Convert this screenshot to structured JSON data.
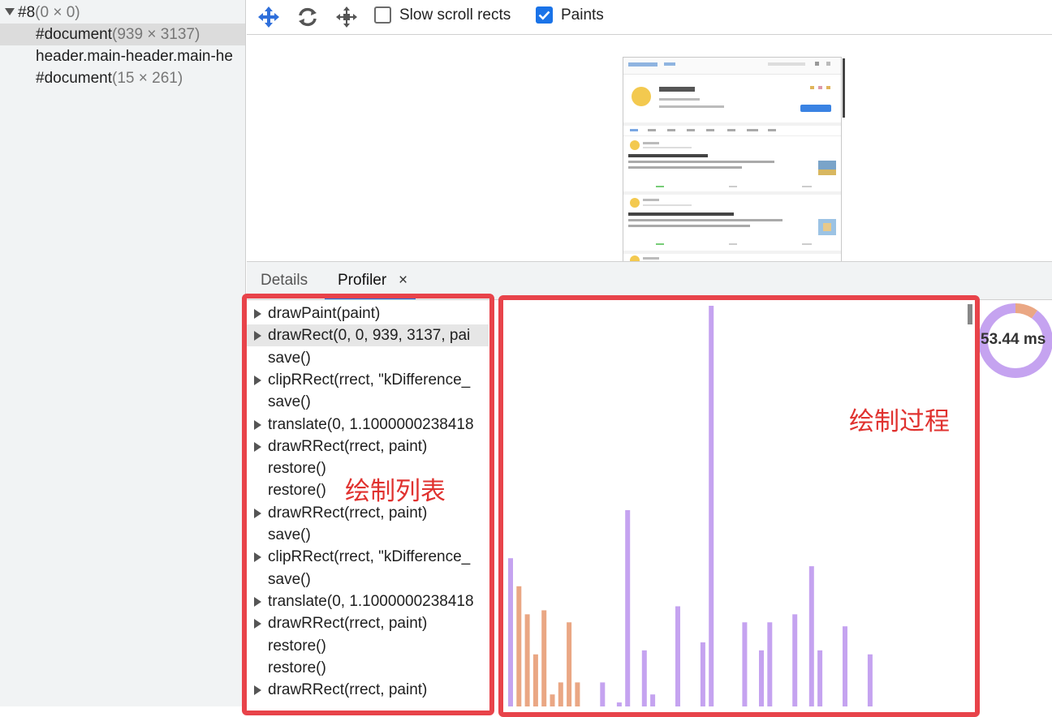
{
  "layer_tree": {
    "rows": [
      {
        "name": "#8",
        "dims": "(0 × 0)",
        "expanded": true,
        "selected": false
      },
      {
        "name": "#document",
        "dims": "(939 × 3137)",
        "selected": true
      },
      {
        "name": "header.main-header.main-he",
        "dims": "",
        "selected": false
      },
      {
        "name": "#document",
        "dims": "(15 × 261)",
        "selected": false
      }
    ]
  },
  "toolbar": {
    "pan_icon": "move-arrows-icon",
    "rotate_icon": "rotate-icon",
    "reset_icon": "reset-transform-icon",
    "slow_scroll_label": "Slow scroll rects",
    "slow_scroll_checked": false,
    "paints_label": "Paints",
    "paints_checked": true
  },
  "tabs": {
    "details": "Details",
    "profiler": "Profiler",
    "close": "×"
  },
  "commands": [
    {
      "text": "drawPaint(paint)",
      "expandable": true
    },
    {
      "text": "drawRect(0, 0, 939, 3137, pai",
      "expandable": true,
      "selected": true
    },
    {
      "text": "save()",
      "expandable": false
    },
    {
      "text": "clipRRect(rrect, \"kDifference_",
      "expandable": true
    },
    {
      "text": "save()",
      "expandable": false
    },
    {
      "text": "translate(0, 1.1000000238418",
      "expandable": true
    },
    {
      "text": "drawRRect(rrect, paint)",
      "expandable": true
    },
    {
      "text": "restore()",
      "expandable": false
    },
    {
      "text": "restore()",
      "expandable": false
    },
    {
      "text": "drawRRect(rrect, paint)",
      "expandable": true
    },
    {
      "text": "save()",
      "expandable": false
    },
    {
      "text": "clipRRect(rrect, \"kDifference_",
      "expandable": true
    },
    {
      "text": "save()",
      "expandable": false
    },
    {
      "text": "translate(0, 1.1000000238418",
      "expandable": true
    },
    {
      "text": "drawRRect(rrect, paint)",
      "expandable": true
    },
    {
      "text": "restore()",
      "expandable": false
    },
    {
      "text": "restore()",
      "expandable": false
    },
    {
      "text": "drawRRect(rrect, paint)",
      "expandable": true
    }
  ],
  "profiler": {
    "total_time": "53.44 ms",
    "donut": {
      "purple_fraction": 0.9,
      "orange_fraction": 0.1
    },
    "colors": {
      "purple": "#c5a3f0",
      "orange": "#eaa784",
      "highlight": "#e8434a"
    },
    "bars": [
      {
        "v": 0.37,
        "c": "purple"
      },
      {
        "v": 0.3,
        "c": "orange"
      },
      {
        "v": 0.23,
        "c": "orange"
      },
      {
        "v": 0.13,
        "c": "orange"
      },
      {
        "v": 0.24,
        "c": "orange"
      },
      {
        "v": 0.03,
        "c": "orange"
      },
      {
        "v": 0.06,
        "c": "orange"
      },
      {
        "v": 0.21,
        "c": "orange"
      },
      {
        "v": 0.06,
        "c": "orange"
      },
      {
        "v": 0.0,
        "c": "purple"
      },
      {
        "v": 0.0,
        "c": "purple"
      },
      {
        "v": 0.06,
        "c": "purple"
      },
      {
        "v": 0.0,
        "c": "purple"
      },
      {
        "v": 0.01,
        "c": "purple"
      },
      {
        "v": 0.49,
        "c": "purple"
      },
      {
        "v": 0.0,
        "c": "purple"
      },
      {
        "v": 0.14,
        "c": "purple"
      },
      {
        "v": 0.03,
        "c": "purple"
      },
      {
        "v": 0.0,
        "c": "purple"
      },
      {
        "v": 0.0,
        "c": "purple"
      },
      {
        "v": 0.25,
        "c": "purple"
      },
      {
        "v": 0.0,
        "c": "purple"
      },
      {
        "v": 0.0,
        "c": "purple"
      },
      {
        "v": 0.16,
        "c": "purple"
      },
      {
        "v": 1.0,
        "c": "purple"
      },
      {
        "v": 0.0,
        "c": "purple"
      },
      {
        "v": 0.0,
        "c": "purple"
      },
      {
        "v": 0.0,
        "c": "purple"
      },
      {
        "v": 0.21,
        "c": "purple"
      },
      {
        "v": 0.0,
        "c": "purple"
      },
      {
        "v": 0.14,
        "c": "purple"
      },
      {
        "v": 0.21,
        "c": "purple"
      },
      {
        "v": 0.0,
        "c": "purple"
      },
      {
        "v": 0.0,
        "c": "purple"
      },
      {
        "v": 0.23,
        "c": "purple"
      },
      {
        "v": 0.0,
        "c": "purple"
      },
      {
        "v": 0.35,
        "c": "purple"
      },
      {
        "v": 0.14,
        "c": "purple"
      },
      {
        "v": 0.0,
        "c": "purple"
      },
      {
        "v": 0.0,
        "c": "purple"
      },
      {
        "v": 0.2,
        "c": "purple"
      },
      {
        "v": 0.0,
        "c": "purple"
      },
      {
        "v": 0.0,
        "c": "purple"
      },
      {
        "v": 0.13,
        "c": "purple"
      }
    ]
  },
  "annotations": {
    "list_label": "绘制列表",
    "timeline_label": "绘制过程"
  }
}
